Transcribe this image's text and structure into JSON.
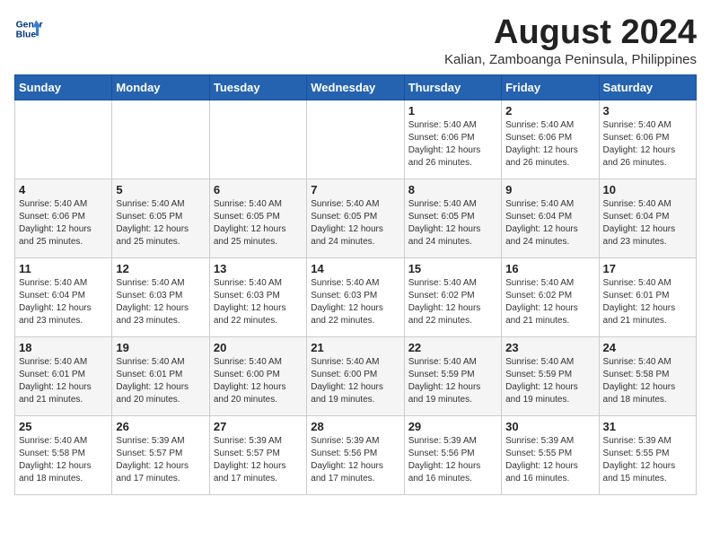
{
  "logo": {
    "line1": "General",
    "line2": "Blue"
  },
  "title": "August 2024",
  "subtitle": "Kalian, Zamboanga Peninsula, Philippines",
  "days_of_week": [
    "Sunday",
    "Monday",
    "Tuesday",
    "Wednesday",
    "Thursday",
    "Friday",
    "Saturday"
  ],
  "weeks": [
    [
      {
        "day": "",
        "info": ""
      },
      {
        "day": "",
        "info": ""
      },
      {
        "day": "",
        "info": ""
      },
      {
        "day": "",
        "info": ""
      },
      {
        "day": "1",
        "info": "Sunrise: 5:40 AM\nSunset: 6:06 PM\nDaylight: 12 hours\nand 26 minutes."
      },
      {
        "day": "2",
        "info": "Sunrise: 5:40 AM\nSunset: 6:06 PM\nDaylight: 12 hours\nand 26 minutes."
      },
      {
        "day": "3",
        "info": "Sunrise: 5:40 AM\nSunset: 6:06 PM\nDaylight: 12 hours\nand 26 minutes."
      }
    ],
    [
      {
        "day": "4",
        "info": "Sunrise: 5:40 AM\nSunset: 6:06 PM\nDaylight: 12 hours\nand 25 minutes."
      },
      {
        "day": "5",
        "info": "Sunrise: 5:40 AM\nSunset: 6:05 PM\nDaylight: 12 hours\nand 25 minutes."
      },
      {
        "day": "6",
        "info": "Sunrise: 5:40 AM\nSunset: 6:05 PM\nDaylight: 12 hours\nand 25 minutes."
      },
      {
        "day": "7",
        "info": "Sunrise: 5:40 AM\nSunset: 6:05 PM\nDaylight: 12 hours\nand 24 minutes."
      },
      {
        "day": "8",
        "info": "Sunrise: 5:40 AM\nSunset: 6:05 PM\nDaylight: 12 hours\nand 24 minutes."
      },
      {
        "day": "9",
        "info": "Sunrise: 5:40 AM\nSunset: 6:04 PM\nDaylight: 12 hours\nand 24 minutes."
      },
      {
        "day": "10",
        "info": "Sunrise: 5:40 AM\nSunset: 6:04 PM\nDaylight: 12 hours\nand 23 minutes."
      }
    ],
    [
      {
        "day": "11",
        "info": "Sunrise: 5:40 AM\nSunset: 6:04 PM\nDaylight: 12 hours\nand 23 minutes."
      },
      {
        "day": "12",
        "info": "Sunrise: 5:40 AM\nSunset: 6:03 PM\nDaylight: 12 hours\nand 23 minutes."
      },
      {
        "day": "13",
        "info": "Sunrise: 5:40 AM\nSunset: 6:03 PM\nDaylight: 12 hours\nand 22 minutes."
      },
      {
        "day": "14",
        "info": "Sunrise: 5:40 AM\nSunset: 6:03 PM\nDaylight: 12 hours\nand 22 minutes."
      },
      {
        "day": "15",
        "info": "Sunrise: 5:40 AM\nSunset: 6:02 PM\nDaylight: 12 hours\nand 22 minutes."
      },
      {
        "day": "16",
        "info": "Sunrise: 5:40 AM\nSunset: 6:02 PM\nDaylight: 12 hours\nand 21 minutes."
      },
      {
        "day": "17",
        "info": "Sunrise: 5:40 AM\nSunset: 6:01 PM\nDaylight: 12 hours\nand 21 minutes."
      }
    ],
    [
      {
        "day": "18",
        "info": "Sunrise: 5:40 AM\nSunset: 6:01 PM\nDaylight: 12 hours\nand 21 minutes."
      },
      {
        "day": "19",
        "info": "Sunrise: 5:40 AM\nSunset: 6:01 PM\nDaylight: 12 hours\nand 20 minutes."
      },
      {
        "day": "20",
        "info": "Sunrise: 5:40 AM\nSunset: 6:00 PM\nDaylight: 12 hours\nand 20 minutes."
      },
      {
        "day": "21",
        "info": "Sunrise: 5:40 AM\nSunset: 6:00 PM\nDaylight: 12 hours\nand 19 minutes."
      },
      {
        "day": "22",
        "info": "Sunrise: 5:40 AM\nSunset: 5:59 PM\nDaylight: 12 hours\nand 19 minutes."
      },
      {
        "day": "23",
        "info": "Sunrise: 5:40 AM\nSunset: 5:59 PM\nDaylight: 12 hours\nand 19 minutes."
      },
      {
        "day": "24",
        "info": "Sunrise: 5:40 AM\nSunset: 5:58 PM\nDaylight: 12 hours\nand 18 minutes."
      }
    ],
    [
      {
        "day": "25",
        "info": "Sunrise: 5:40 AM\nSunset: 5:58 PM\nDaylight: 12 hours\nand 18 minutes."
      },
      {
        "day": "26",
        "info": "Sunrise: 5:39 AM\nSunset: 5:57 PM\nDaylight: 12 hours\nand 17 minutes."
      },
      {
        "day": "27",
        "info": "Sunrise: 5:39 AM\nSunset: 5:57 PM\nDaylight: 12 hours\nand 17 minutes."
      },
      {
        "day": "28",
        "info": "Sunrise: 5:39 AM\nSunset: 5:56 PM\nDaylight: 12 hours\nand 17 minutes."
      },
      {
        "day": "29",
        "info": "Sunrise: 5:39 AM\nSunset: 5:56 PM\nDaylight: 12 hours\nand 16 minutes."
      },
      {
        "day": "30",
        "info": "Sunrise: 5:39 AM\nSunset: 5:55 PM\nDaylight: 12 hours\nand 16 minutes."
      },
      {
        "day": "31",
        "info": "Sunrise: 5:39 AM\nSunset: 5:55 PM\nDaylight: 12 hours\nand 15 minutes."
      }
    ]
  ]
}
